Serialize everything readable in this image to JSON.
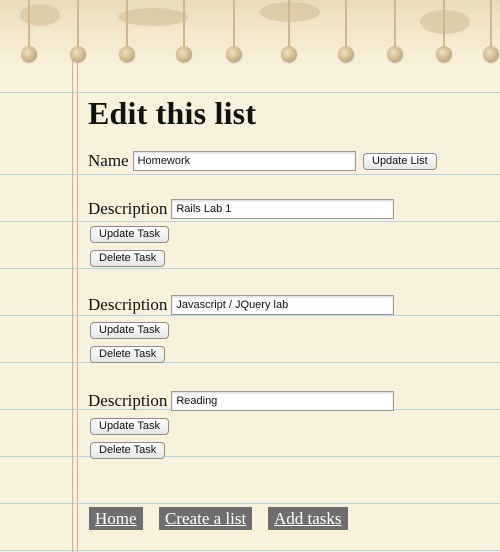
{
  "page": {
    "heading": "Edit this list"
  },
  "list_form": {
    "name_label": "Name",
    "name_value": "Homework",
    "update_button": "Update List"
  },
  "tasks": [
    {
      "description_label": "Description",
      "value": "Rails Lab 1",
      "update_button": "Update Task",
      "delete_button": "Delete Task"
    },
    {
      "description_label": "Description",
      "value": "Javascript / JQuery lab",
      "update_button": "Update Task",
      "delete_button": "Delete Task"
    },
    {
      "description_label": "Description",
      "value": "Reading",
      "update_button": "Update Task",
      "delete_button": "Delete Task"
    }
  ],
  "nav": {
    "home": "Home",
    "create_list": "Create a list",
    "add_tasks": "Add tasks"
  },
  "colors": {
    "paper": "#f8f1dc",
    "rule_line": "#b9d3e4",
    "margin_line": "#e2a7a0",
    "nav_bg": "#6e6e6e"
  }
}
